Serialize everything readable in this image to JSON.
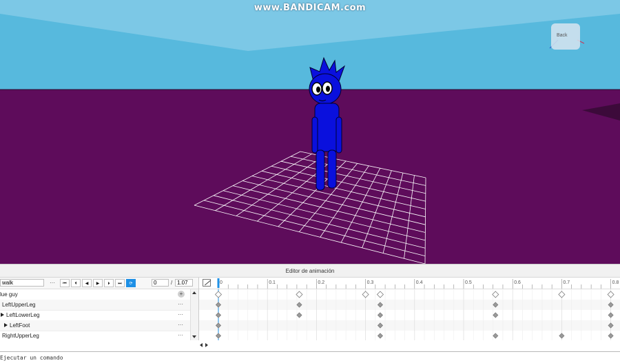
{
  "watermark": "www.BANDICAM.com",
  "viewport": {
    "view_cube_label": "Back",
    "colors": {
      "sky": "#57b9dd",
      "ground": "#5e0c5b",
      "character": "#0a10dd",
      "grid": "#ffffff"
    }
  },
  "editor": {
    "title": "Editor de animación",
    "animation_name": "walk",
    "more_label": "···",
    "playback_buttons": [
      {
        "icon": "skip-to-start-icon",
        "glyph": "⏮"
      },
      {
        "icon": "previous-keyframe-icon",
        "glyph": "⏴"
      },
      {
        "icon": "play-reverse-icon",
        "glyph": "◀"
      },
      {
        "icon": "play-icon",
        "glyph": "▶"
      },
      {
        "icon": "next-keyframe-icon",
        "glyph": "⏵"
      },
      {
        "icon": "skip-to-end-icon",
        "glyph": "⏭"
      },
      {
        "icon": "loop-icon",
        "glyph": "⟳"
      }
    ],
    "current_time": "0",
    "time_separator": "/",
    "total_time": "1.07",
    "ruler_ticks": [
      "0",
      "0.1",
      "0.2",
      "0.3",
      "0.4",
      "0.5",
      "0.6",
      "0.7",
      "0.8"
    ],
    "accent_color": "#1e90e6",
    "tracks": [
      {
        "label": "lue guy",
        "indent": 0,
        "expander": false,
        "action": "+",
        "keyframes": [
          0,
          0.165,
          0.3,
          0.33,
          0.565,
          0.7,
          0.8
        ],
        "style": "outline"
      },
      {
        "label": "LeftUpperLeg",
        "indent": 1,
        "expander": false,
        "action": "···",
        "keyframes": [
          0,
          0.165,
          0.33,
          0.565,
          0.8
        ],
        "style": "filled"
      },
      {
        "label": "LeftLowerLeg",
        "indent": 1,
        "expander": true,
        "action": "···",
        "keyframes": [
          0,
          0.165,
          0.33,
          0.565,
          0.8
        ],
        "style": "filled"
      },
      {
        "label": "LeftFoot",
        "indent": 2,
        "expander": true,
        "action": "···",
        "keyframes": [
          0,
          0.33,
          0.8
        ],
        "style": "filled"
      },
      {
        "label": "RightUpperLeg",
        "indent": 1,
        "expander": false,
        "action": "···",
        "keyframes": [
          0,
          0.33,
          0.565,
          0.7,
          0.8
        ],
        "style": "filled"
      }
    ]
  },
  "command_bar": {
    "placeholder": "Ejecutar un comando"
  }
}
